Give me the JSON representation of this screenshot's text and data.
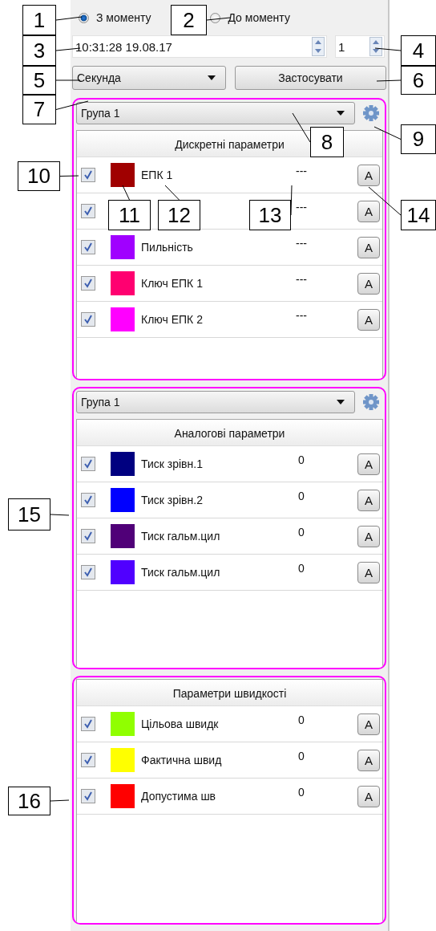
{
  "time_mode": [
    {
      "label": "З моменту",
      "selected": true
    },
    {
      "label": "До моменту",
      "selected": false
    }
  ],
  "datetime_field": {
    "value": "10:31:28 19.08.17"
  },
  "count_field": {
    "value": "1"
  },
  "unit_select": {
    "value": "Секунда"
  },
  "apply_button": {
    "label": "Застосувати"
  },
  "sections": [
    {
      "group_select": {
        "value": "Група 1"
      },
      "title": "Дискретні параметри",
      "rows": [
        {
          "checked": true,
          "color": "#a00000",
          "name": "ЕПК 1",
          "value": "---",
          "button": "A"
        },
        {
          "checked": true,
          "value": "---",
          "button": "A"
        },
        {
          "checked": true,
          "color": "#a000ff",
          "name": "Пильність",
          "value": "---",
          "button": "A"
        },
        {
          "checked": true,
          "color": "#ff0070",
          "name": "Ключ ЕПК 1",
          "value": "---",
          "button": "A"
        },
        {
          "checked": true,
          "color": "#ff00ff",
          "name": "Ключ ЕПК 2",
          "value": "---",
          "button": "A"
        }
      ]
    },
    {
      "group_select": {
        "value": "Група 1"
      },
      "title": "Аналогові параметри",
      "rows": [
        {
          "checked": true,
          "color": "#000080",
          "name": "Тиск зрівн.1",
          "value": "0",
          "button": "A"
        },
        {
          "checked": true,
          "color": "#0000ff",
          "name": "Тиск зрівн.2",
          "value": "0",
          "button": "A"
        },
        {
          "checked": true,
          "color": "#500078",
          "name": "Тиск гальм.цил",
          "value": "0",
          "button": "A"
        },
        {
          "checked": true,
          "color": "#5000ff",
          "name": "Тиск гальм.цил",
          "value": "0",
          "button": "A"
        }
      ]
    },
    {
      "title": "Параметри швидкості",
      "rows": [
        {
          "checked": true,
          "color": "#90ff00",
          "name": "Цільова швидк",
          "value": "0",
          "button": "A"
        },
        {
          "checked": true,
          "color": "#ffff00",
          "name": "Фактична швид",
          "value": "0",
          "button": "A"
        },
        {
          "checked": true,
          "color": "#ff0000",
          "name": "Допустима шв",
          "value": "0",
          "button": "A"
        }
      ]
    }
  ],
  "callouts": [
    "1",
    "2",
    "3",
    "4",
    "5",
    "6",
    "7",
    "8",
    "9",
    "10",
    "11",
    "12",
    "13",
    "14",
    "15",
    "16"
  ]
}
